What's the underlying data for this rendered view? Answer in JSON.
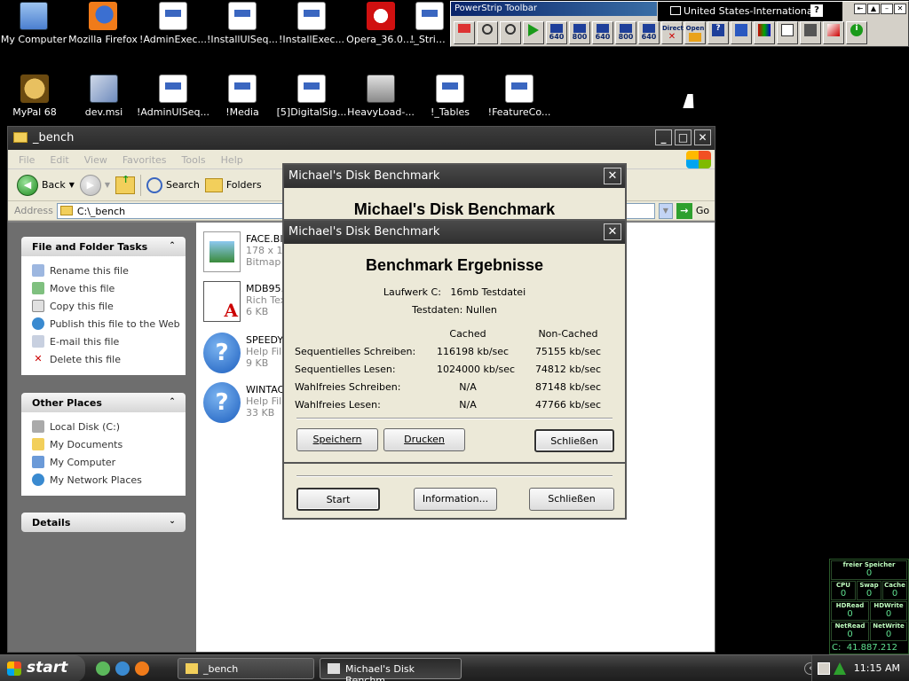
{
  "desktop": {
    "row1": [
      {
        "label": "My Computer",
        "icon": "my-computer-icon"
      },
      {
        "label": "Mozilla Firefox",
        "icon": "firefox-icon"
      },
      {
        "label": "!AdminExec...",
        "icon": "document-icon"
      },
      {
        "label": "!InstallUISeq...",
        "icon": "document-icon"
      },
      {
        "label": "!InstallExec...",
        "icon": "document-icon"
      },
      {
        "label": "Opera_36.0....",
        "icon": "opera-icon"
      },
      {
        "label": "!_Strin...",
        "icon": "document-icon"
      }
    ],
    "row2": [
      {
        "label": "MyPal 68",
        "icon": "mypal-icon"
      },
      {
        "label": "dev.msi",
        "icon": "msi-icon"
      },
      {
        "label": "!AdminUISeq...",
        "icon": "document-icon"
      },
      {
        "label": "!Media",
        "icon": "document-icon"
      },
      {
        "label": "[5]DigitalSig...",
        "icon": "document-icon"
      },
      {
        "label": "HeavyLoad-...",
        "icon": "heavyload-icon"
      },
      {
        "label": "!_Tables",
        "icon": "document-icon"
      },
      {
        "label": "!FeatureCo...",
        "icon": "document-icon"
      }
    ]
  },
  "powerstrip": {
    "title": "PowerStrip Toolbar",
    "language": "United States-International",
    "help": "?",
    "buttons": [
      {
        "label": "",
        "icon": "edit-icon"
      },
      {
        "label": "",
        "icon": "zoom-in-icon"
      },
      {
        "label": "",
        "icon": "zoom-out-icon"
      },
      {
        "label": "",
        "icon": "play-icon"
      },
      {
        "label": "640",
        "icon": "res-8-icon"
      },
      {
        "label": "800",
        "icon": "res-8-icon"
      },
      {
        "label": "640",
        "icon": "res-16-icon"
      },
      {
        "label": "800",
        "icon": "res-16-icon"
      },
      {
        "label": "640",
        "icon": "res-8-icon"
      },
      {
        "label": "Direct",
        "icon": "directx-icon"
      },
      {
        "label": "Open",
        "icon": "opengl-icon"
      },
      {
        "label": "",
        "icon": "help-icon"
      },
      {
        "label": "",
        "icon": "move-icon"
      },
      {
        "label": "",
        "icon": "color-icon"
      },
      {
        "label": "",
        "icon": "gamma-icon"
      },
      {
        "label": "",
        "icon": "tools-icon"
      },
      {
        "label": "",
        "icon": "paint-icon"
      },
      {
        "label": "",
        "icon": "info-icon"
      }
    ]
  },
  "explorer": {
    "title": "_bench",
    "menu": [
      "File",
      "Edit",
      "View",
      "Favorites",
      "Tools",
      "Help"
    ],
    "toolbar": {
      "back": "Back",
      "search": "Search",
      "folders": "Folders"
    },
    "address_label": "Address",
    "address_value": "C:\\_bench",
    "go": "Go",
    "tasks": {
      "file_folder_title": "File and Folder Tasks",
      "file_folder_items": [
        "Rename this file",
        "Move this file",
        "Copy this file",
        "Publish this file to the Web",
        "E-mail this file",
        "Delete this file"
      ],
      "other_title": "Other Places",
      "other_items": [
        "Local Disk (C:)",
        "My Documents",
        "My Computer",
        "My Network Places"
      ],
      "details_title": "Details"
    },
    "files": [
      {
        "name": "FACE.BI",
        "line2": "178 x 1",
        "line3": "Bitmap I",
        "icon": "bitmap-file-icon"
      },
      {
        "name": "MDB95.",
        "line2": "Rich Tex",
        "line3": "6 KB",
        "icon": "rtf-file-icon"
      },
      {
        "name": "SPEEDY",
        "line2": "Help File",
        "line3": "9 KB",
        "icon": "help-file-icon"
      },
      {
        "name": "WINTAC",
        "line2": "Help File",
        "line3": "33 KB",
        "icon": "help-file-icon"
      }
    ]
  },
  "dialog_main": {
    "title": "Michael's Disk Benchmark",
    "heading": "Michael's Disk Benchmark",
    "start": "Start",
    "information": "Information...",
    "close": "Schließen"
  },
  "dialog_results": {
    "title": "Michael's Disk Benchmark",
    "heading": "Benchmark Ergebnisse",
    "drive_line": "Laufwerk C:   16mb Testdatei",
    "data_line": "Testdaten: Nullen",
    "col_cached": "Cached",
    "col_noncached": "Non-Cached",
    "rows": [
      {
        "label": "Sequentielles Schreiben:",
        "cached": "116198 kb/sec",
        "noncached": "75155 kb/sec"
      },
      {
        "label": "Sequentielles Lesen:",
        "cached": "1024000 kb/sec",
        "noncached": "74812 kb/sec"
      },
      {
        "label": "Wahlfreies Schreiben:",
        "cached": "N/A",
        "noncached": "87148 kb/sec"
      },
      {
        "label": "Wahlfreies Lesen:",
        "cached": "N/A",
        "noncached": "47766 kb/sec"
      }
    ],
    "save": "Speichern",
    "print": "Drucken",
    "close": "Schließen"
  },
  "taskbar": {
    "start": "start",
    "tasks": [
      "_bench",
      "Michael's Disk Benchm..."
    ],
    "clock": "11:15 AM"
  },
  "monitor": {
    "title": "freier Speicher",
    "free": "0",
    "cells": [
      {
        "label": "CPU",
        "value": "0"
      },
      {
        "label": "Swap",
        "value": "0"
      },
      {
        "label": "Cache",
        "value": "0"
      },
      {
        "label": "HDRead",
        "value": "0"
      },
      {
        "label": "HDWrite",
        "value": "0"
      },
      {
        "label": "NetRead",
        "value": "0"
      },
      {
        "label": "NetWrite",
        "value": "0"
      }
    ],
    "disk": "C:  41.887.212"
  },
  "colors": {
    "title_dark": "#2f2f2f",
    "xp_blue": "#0a246a",
    "monitor_green": "#3fd07a"
  }
}
